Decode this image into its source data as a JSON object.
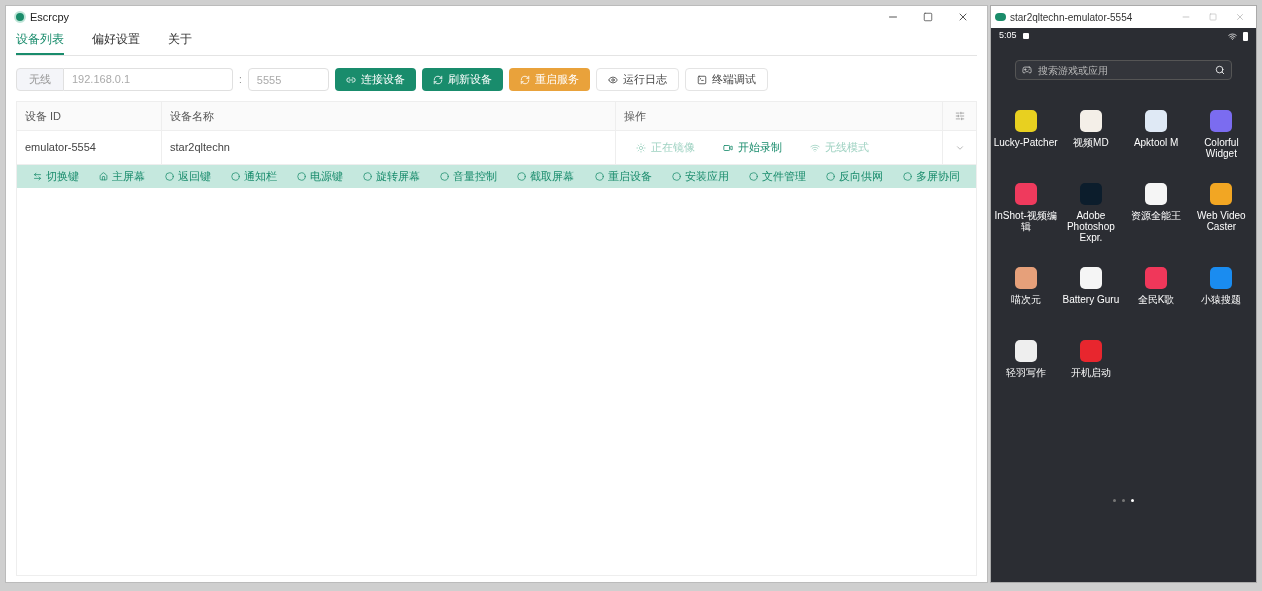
{
  "main_window": {
    "title": "Escrcpy",
    "tabs": [
      {
        "label": "设备列表",
        "selected": true
      },
      {
        "label": "偏好设置",
        "selected": false
      },
      {
        "label": "关于",
        "selected": false
      }
    ],
    "connect_bar": {
      "prefix": "无线",
      "host_placeholder": "192.168.0.1",
      "separator": ":",
      "port_placeholder": "5555",
      "buttons": [
        {
          "label": "连接设备",
          "kind": "primary"
        },
        {
          "label": "刷新设备",
          "kind": "primary"
        },
        {
          "label": "重启服务",
          "kind": "warning"
        },
        {
          "label": "运行日志",
          "kind": "plain"
        },
        {
          "label": "终端调试",
          "kind": "plain"
        }
      ]
    },
    "table": {
      "columns": [
        "设备 ID",
        "设备名称",
        "操作"
      ],
      "rows": [
        {
          "id": "emulator-5554",
          "name": "star2qltechn",
          "actions": [
            {
              "label": "正在镜像",
              "disabled": true
            },
            {
              "label": "开始录制",
              "disabled": false
            },
            {
              "label": "无线模式",
              "disabled": true
            }
          ],
          "expanded": true,
          "controls": [
            "切换键",
            "主屏幕",
            "返回键",
            "通知栏",
            "电源键",
            "旋转屏幕",
            "音量控制",
            "截取屏幕",
            "重启设备",
            "安装应用",
            "文件管理",
            "反向供网",
            "多屏协同"
          ]
        }
      ]
    }
  },
  "mirror_window": {
    "title": "star2qltechn-emulator-5554",
    "time": "5:05",
    "search_placeholder": "搜索游戏或应用",
    "apps": [
      {
        "label": "Lucky-Patcher",
        "color": "#e8d020"
      },
      {
        "label": "视频MD",
        "color": "#f4efe8"
      },
      {
        "label": "Apktool M",
        "color": "#dfe9f5"
      },
      {
        "label": "Colorful Widget",
        "color": "#7b6cf0"
      },
      {
        "label": "InShot-视频编辑",
        "color": "#ef3a5d"
      },
      {
        "label": "Adobe Photoshop Expr.",
        "color": "#0c1d2c"
      },
      {
        "label": "资源全能王",
        "color": "#f5f5f5"
      },
      {
        "label": "Web Video Caster",
        "color": "#f2a623"
      },
      {
        "label": "喵次元",
        "color": "#e6a07a"
      },
      {
        "label": "Battery Guru",
        "color": "#f5f5f5"
      },
      {
        "label": "全民K歌",
        "color": "#f0375a"
      },
      {
        "label": "小猿搜题",
        "color": "#1a8cf0"
      },
      {
        "label": "轻羽写作",
        "color": "#eeeeee"
      },
      {
        "label": "开机启动",
        "color": "#e8262e"
      }
    ],
    "pages": [
      {
        "selected": false
      },
      {
        "selected": false
      },
      {
        "selected": true
      }
    ]
  }
}
